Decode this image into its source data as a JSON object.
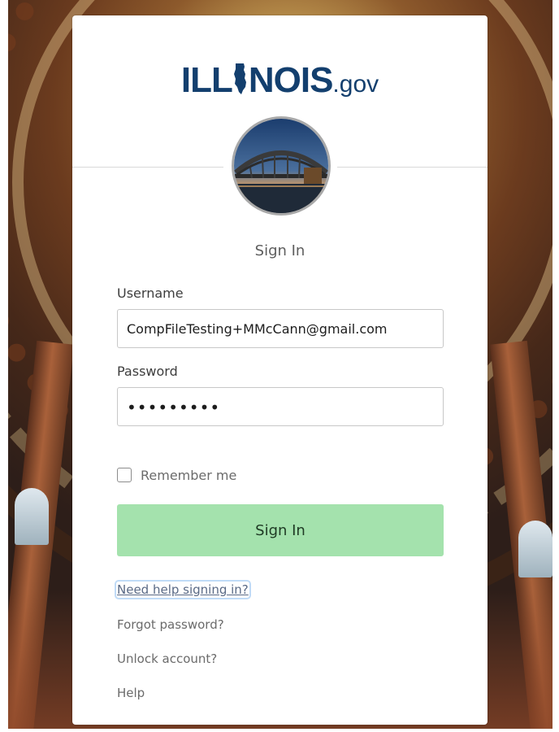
{
  "brand": {
    "logo_main_left": "ILL",
    "logo_main_right": "NOIS",
    "logo_suffix": ".gov"
  },
  "form": {
    "title": "Sign In",
    "username_label": "Username",
    "username_value": "CompFileTesting+MMcCann@gmail.com",
    "password_label": "Password",
    "password_value": "•••••••••",
    "remember_label": "Remember me",
    "remember_checked": false,
    "submit_label": "Sign In"
  },
  "links": {
    "need_help": "Need help signing in?",
    "forgot_password": "Forgot password?",
    "unlock_account": "Unlock account?",
    "help": "Help"
  },
  "colors": {
    "brand_blue": "#133f6e",
    "button_green": "#a4e2ad"
  }
}
